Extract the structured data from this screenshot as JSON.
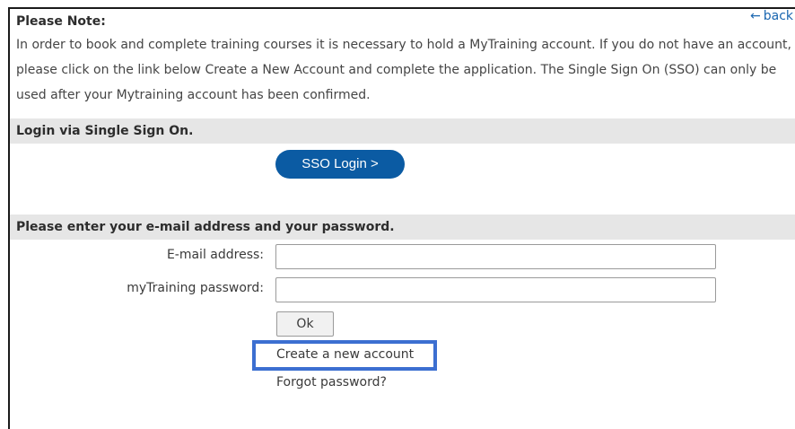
{
  "note": {
    "title": "Please Note:",
    "back_label": "back",
    "body": "In order to book and complete training courses it is necessary to hold a MyTraining account. If you do not have an account, please click on the link below Create a New Account and complete the application. The Single Sign On (SSO) can only be used after your Mytraining account has been confirmed."
  },
  "sso": {
    "heading": "Login via Single Sign On.",
    "button_label": "SSO Login >"
  },
  "login": {
    "heading": "Please enter your e-mail address and your password.",
    "email_label": "E-mail address:",
    "email_value": "",
    "password_label": "myTraining password:",
    "password_value": "",
    "ok_label": "Ok",
    "create_account_label": "Create a new account",
    "forgot_password_label": "Forgot password?"
  },
  "colors": {
    "accent_button": "#0b5ba3",
    "highlight": "#3c6fd1",
    "section_bar": "#e6e6e6",
    "link": "#1a66b0"
  },
  "icons": {
    "back": "arrow-left-icon"
  }
}
